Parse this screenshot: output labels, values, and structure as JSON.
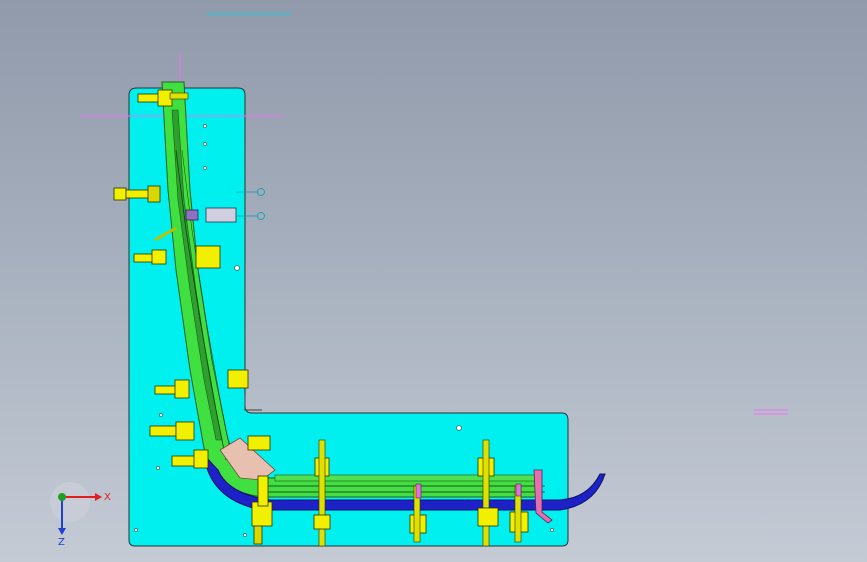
{
  "triad": {
    "x_label": "X",
    "z_label": "Z",
    "x_color": "#e02020",
    "y_color": "#20a020",
    "z_color": "#2040d0"
  },
  "colors": {
    "background_top": "#919aab",
    "background_bottom": "#c4cbd5",
    "base_plate": "#00f0f0",
    "profile_green": "#40e040",
    "profile_blue": "#1c22c8",
    "clamp_yellow": "#f0f000",
    "guide_magenta": "#f070f0",
    "guide_cyan": "#00d0e0"
  }
}
